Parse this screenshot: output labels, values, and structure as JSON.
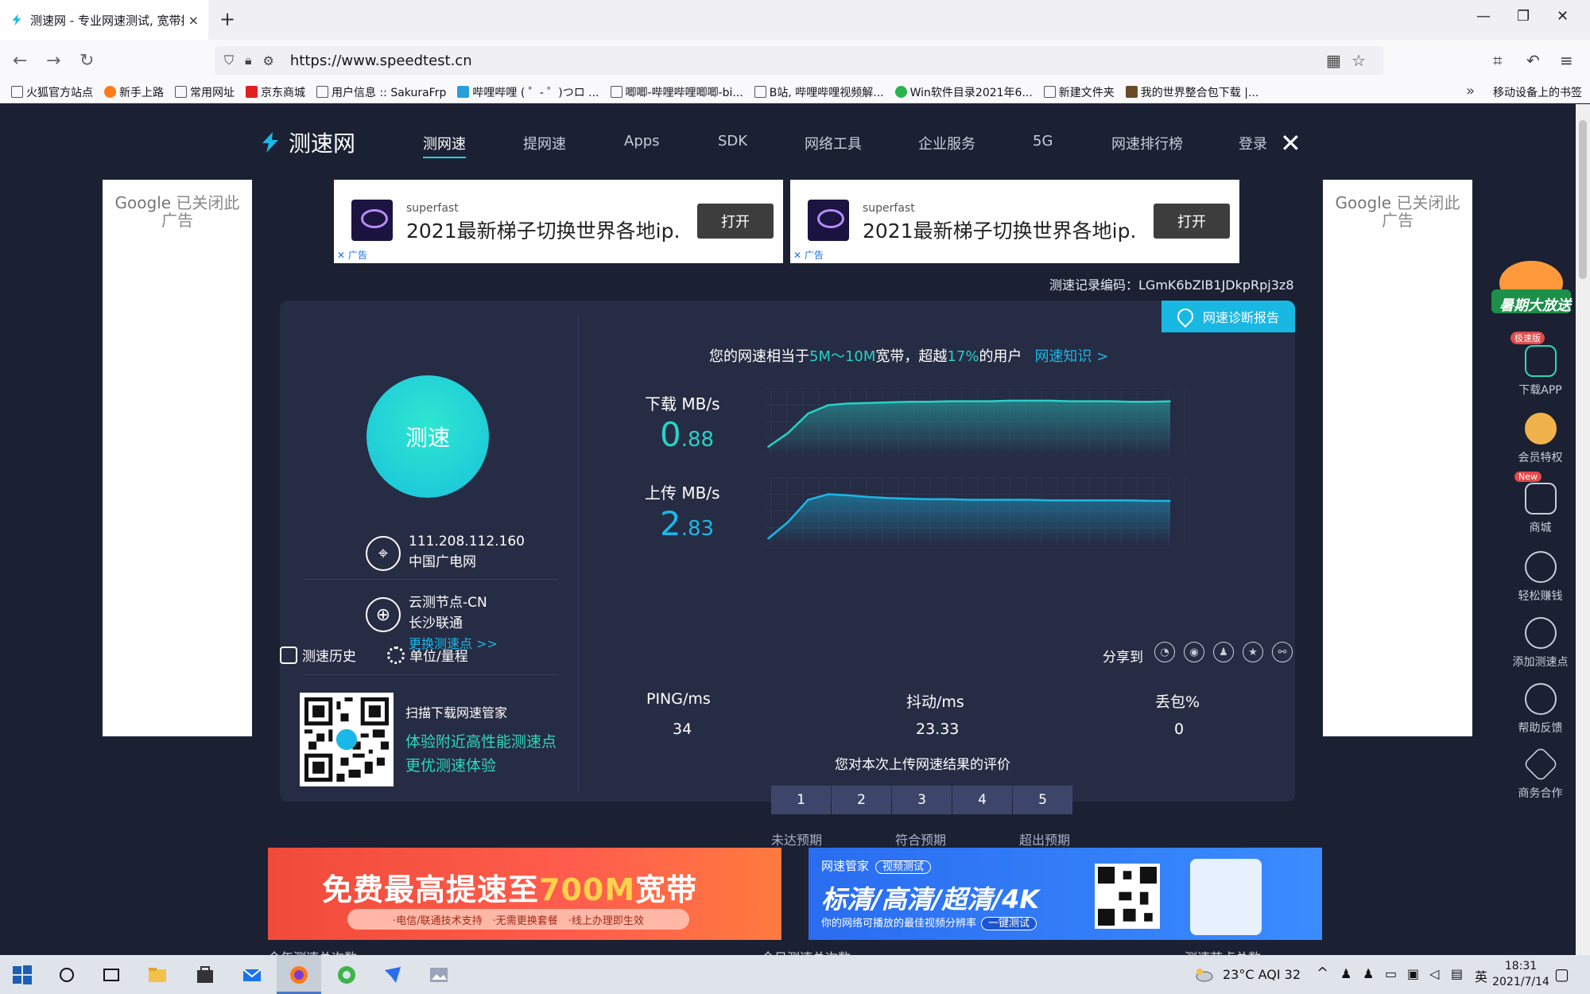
{
  "browser": {
    "tab_title": "测速网 - 专业网速测试, 宽带提速",
    "tab_close": "×",
    "new_tab": "+",
    "url": "https://www.speedtest.cn",
    "bookmarks": [
      "火狐官方站点",
      "新手上路",
      "常用网址",
      "京东商城",
      "用户信息 :: SakuraFrp",
      "哔哩哔哩 ( ゜- ゜)つロ ...",
      "唧唧-哔哩哔哩唧唧-bi...",
      "B站, 哔哩哔哩视频解...",
      "Win软件目录2021年6...",
      "新建文件夹",
      "我的世界整合包下载 |..."
    ],
    "bookmarks_more": "»",
    "mobile_bookmarks": "移动设备上的书签"
  },
  "site": {
    "logo_text": "测速网",
    "menu": [
      "测网速",
      "提网速",
      "Apps",
      "SDK",
      "网络工具",
      "企业服务",
      "5G",
      "网速排行榜"
    ],
    "login": "登录",
    "close": "✕"
  },
  "ads": {
    "google_left": "Google",
    "google_left_2": "已关闭此",
    "google_left_3": "广告",
    "google_right": "Google",
    "google_right_2": "已关闭此",
    "google_right_3": "广告",
    "top": [
      {
        "brand": "superfast",
        "slogan": "2021最新梯子切换世界各地ip.",
        "button": "打开",
        "tag": "✕ 广告"
      },
      {
        "brand": "superfast",
        "slogan": "2021最新梯子切换世界各地ip.",
        "button": "打开",
        "tag": "✕ 广告"
      }
    ],
    "red_banner": {
      "title_1": "免费最高提速至",
      "title_2": "700M",
      "title_3": "宽带",
      "sub": "·电信/联通技术支持　·无需更换套餐　·线上办理即生效"
    },
    "blue_banner": {
      "brand": "网速管家",
      "pill": "视频测试",
      "title": "标清/高清/超清/4K",
      "sub": "你的网络可播放的最佳视频分辨率",
      "button": "一键测试"
    }
  },
  "record": "测速记录编码：LGmK6bZIB1JDkpRpj3z8",
  "diag_button": "网速诊断报告",
  "speed_button": "测速",
  "client": {
    "ip": "111.208.112.160",
    "isp": "中国广电网"
  },
  "node": {
    "name": "云测节点-CN",
    "location": "长沙联通",
    "change": "更换测速点 >>"
  },
  "qr": {
    "label": "扫描下载网速管家",
    "promo_1": "体验附近高性能测速点",
    "promo_2": "更优测速体验"
  },
  "headline": {
    "prefix": "您的网速相当于",
    "band": "5M～10M",
    "mid": "宽带，超越",
    "pct": "17%",
    "suffix": "的用户",
    "link": "网速知识 >"
  },
  "download": {
    "label": "下载 MB/s",
    "int": "0",
    "dec": ".88"
  },
  "upload": {
    "label": "上传 MB/s",
    "int": "2",
    "dec": ".83"
  },
  "stats": {
    "ping_label": "PING/ms",
    "ping": "34",
    "jitter_label": "抖动/ms",
    "jitter": "23.33",
    "loss_label": "丢包%",
    "loss": "0"
  },
  "rating": {
    "title": "您对本次上传网速结果的评价",
    "options": [
      "1",
      "2",
      "3",
      "4",
      "5"
    ],
    "low": "未达预期",
    "mid": "符合预期",
    "high": "超出预期"
  },
  "toolbar": {
    "history": "测速历史",
    "units": "单位/量程",
    "share": "分享到"
  },
  "below": {
    "year_total": "今年测速总次数",
    "day_total": "今日测速总次数",
    "node_total": "测速节点总数"
  },
  "sidebar": {
    "promo": "暑期大放送",
    "fast_tag": "极速版",
    "new_tag": "New",
    "items": [
      "下载APP",
      "会员特权",
      "商城",
      "轻松赚钱",
      "添加测速点",
      "帮助反馈",
      "商务合作"
    ]
  },
  "taskbar": {
    "weather": "23°C  AQI 32",
    "lang": "英",
    "time": "18:31",
    "date": "2021/7/14"
  },
  "chart_data": [
    {
      "type": "area",
      "title": "下载 MB/s",
      "x": [
        0,
        1,
        2,
        3,
        4,
        5,
        6,
        7,
        8,
        9,
        10,
        11,
        12,
        13,
        14,
        15,
        16,
        17,
        18,
        19,
        20
      ],
      "values": [
        0.1,
        0.35,
        0.7,
        0.85,
        0.88,
        0.89,
        0.9,
        0.91,
        0.91,
        0.92,
        0.92,
        0.92,
        0.93,
        0.93,
        0.93,
        0.92,
        0.92,
        0.92,
        0.91,
        0.91,
        0.92
      ],
      "ylim": [
        0,
        1.1
      ],
      "color": "#26d2c8"
    },
    {
      "type": "area",
      "title": "上传 MB/s",
      "x": [
        0,
        1,
        2,
        3,
        4,
        5,
        6,
        7,
        8,
        9,
        10,
        11,
        12,
        13,
        14,
        15,
        16,
        17,
        18,
        19,
        20
      ],
      "values": [
        0.05,
        0.35,
        0.75,
        0.85,
        0.83,
        0.8,
        0.78,
        0.77,
        0.76,
        0.76,
        0.75,
        0.75,
        0.75,
        0.75,
        0.74,
        0.74,
        0.74,
        0.74,
        0.74,
        0.73,
        0.73
      ],
      "ylim": [
        0,
        1.1
      ],
      "color": "#1ab8e8"
    }
  ]
}
